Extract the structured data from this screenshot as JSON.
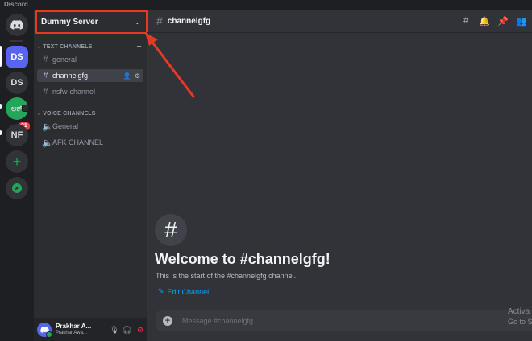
{
  "app": {
    "title": "Discord"
  },
  "guilds": [
    {
      "label": "DS",
      "active": true
    },
    {
      "label": "DS"
    },
    {
      "label": "ಅಕ್",
      "badge": "21"
    },
    {
      "label": "NF"
    }
  ],
  "server": {
    "name": "Dummy Server"
  },
  "categories": {
    "text": "TEXT CHANNELS",
    "voice": "VOICE CHANNELS"
  },
  "text_channels": [
    {
      "name": "general"
    },
    {
      "name": "channelgfg",
      "selected": true
    },
    {
      "name": "nsfw-channel"
    }
  ],
  "voice_channels": [
    {
      "name": "General"
    },
    {
      "name": "AFK CHANNEL"
    }
  ],
  "user": {
    "name": "Prakhar A...",
    "status": "Prakhar Awa..."
  },
  "header": {
    "channel": "channelgfg"
  },
  "welcome": {
    "heading": "Welcome to #channelgfg!",
    "subtitle": "This is the start of the #channelgfg channel.",
    "edit_label": "Edit Channel"
  },
  "composer": {
    "placeholder": "Message #channelgfg"
  },
  "watermark": {
    "line1": "Activa",
    "line2": "Go to Se"
  },
  "colors": {
    "accent": "#5865f2",
    "highlight": "#e53a24",
    "link": "#00a8fc",
    "online": "#23a55a",
    "danger": "#f23f43"
  }
}
